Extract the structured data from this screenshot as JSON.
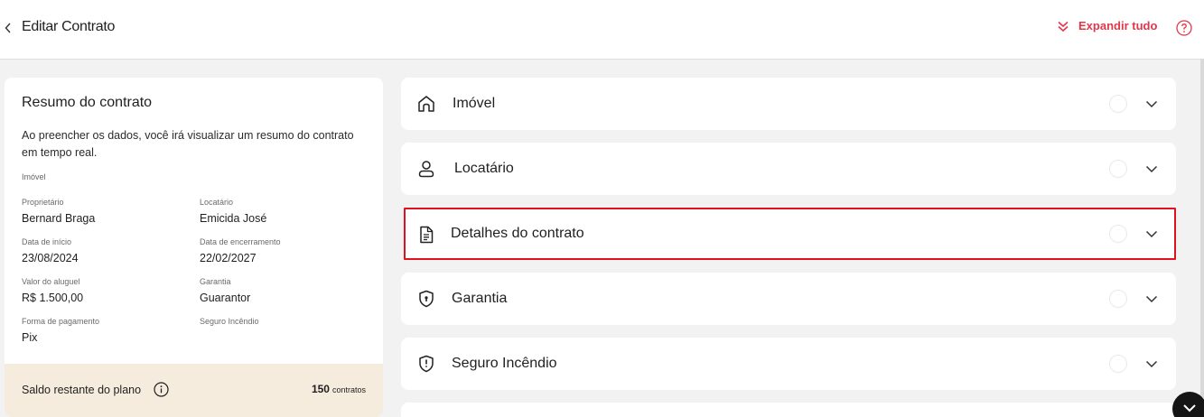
{
  "header": {
    "title": "Editar Contrato",
    "expand_all": "Expandir tudo",
    "accent_color": "#e0384b"
  },
  "summary": {
    "title": "Resumo do contrato",
    "description": "Ao preencher os dados, você irá visualizar um resumo do contrato em tempo real.",
    "section_label": "Imóvel",
    "fields": [
      {
        "label": "Proprietário",
        "value": "Bernard Braga"
      },
      {
        "label": "Locatário",
        "value": "Emicida José"
      },
      {
        "label": "Data de início",
        "value": "23/08/2024"
      },
      {
        "label": "Data de encerramento",
        "value": "22/02/2027"
      },
      {
        "label": "Valor do aluguel",
        "value": "R$ 1.500,00"
      },
      {
        "label": "Garantia",
        "value": "Guarantor"
      },
      {
        "label": "Forma de pagamento",
        "value": "Pix"
      },
      {
        "label": "Seguro Incêndio",
        "value": ""
      }
    ],
    "plan": {
      "label": "Saldo restante do plano",
      "count": "150",
      "unit": "contratos"
    }
  },
  "sections": [
    {
      "label": "Imóvel",
      "icon": "home-icon"
    },
    {
      "label": "Locatário",
      "icon": "user-icon"
    },
    {
      "label": "Detalhes do contrato",
      "icon": "document-icon",
      "highlighted": true
    },
    {
      "label": "Garantia",
      "icon": "shield-lock-icon"
    },
    {
      "label": "Seguro Incêndio",
      "icon": "shield-alert-icon"
    }
  ],
  "highlight_color": "#e0121f"
}
